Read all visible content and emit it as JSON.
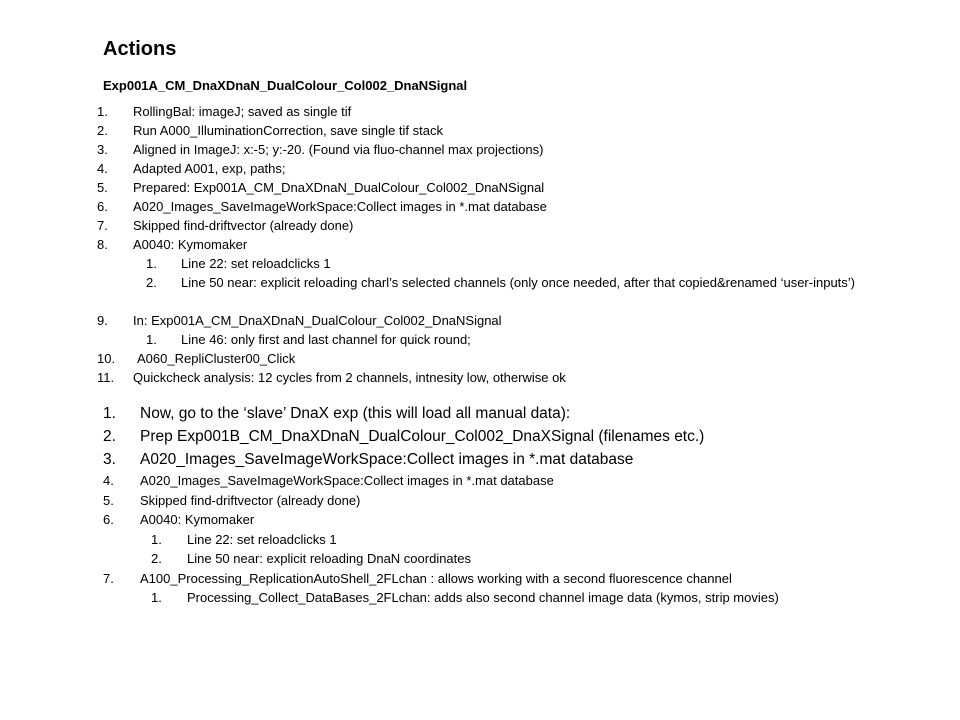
{
  "slide": {
    "title": "Actions",
    "subtitle": "Exp001A_CM_DnaXDnaN_DualColour_Col002_DnaNSignal",
    "section1": [
      {
        "num": "1.",
        "text": "RollingBal: imageJ; saved as single tif"
      },
      {
        "num": "2.",
        "text": "Run A000_IlluminationCorrection,  save single tif stack"
      },
      {
        "num": "3.",
        "text": "Aligned in ImageJ: x:-5; y:-20. (Found via fluo-channel max projections)"
      },
      {
        "num": "4.",
        "text": "Adapted A001, exp, paths;"
      },
      {
        "num": "5.",
        "text": "Prepared: Exp001A_CM_DnaXDnaN_DualColour_Col002_DnaNSignal"
      },
      {
        "num": "6.",
        "text": "A020_Images_SaveImageWorkSpace:Collect images in *.mat database"
      },
      {
        "num": "7.",
        "text": "Skipped find-driftvector (already done)"
      },
      {
        "num": "8.",
        "text": "A0040: Kymomaker"
      },
      {
        "num": "1.",
        "text": "Line 22: set reloadclicks 1"
      },
      {
        "num": "2.",
        "text": "Line 50 near: explicit reloading charl’s selected channels (only once needed, after that copied&renamed ‘user-inputs’)"
      },
      {
        "num": "9.",
        "text": "In: Exp001A_CM_DnaXDnaN_DualColour_Col002_DnaNSignal"
      },
      {
        "num": "1.",
        "text": "Line 46: only first and last channel for quick round;"
      },
      {
        "num": "10.",
        "text": "A060_RepliCluster00_Click"
      },
      {
        "num": "11.",
        "text": "Quickcheck analysis: 12 cycles from 2 channels, intnesity low, otherwise ok"
      }
    ],
    "section2": [
      {
        "num": "1.",
        "text": "Now, go to the ‘slave’  DnaX exp (this will load all manual data):"
      },
      {
        "num": "2.",
        "text": "Prep Exp001B_CM_DnaXDnaN_DualColour_Col002_DnaXSignal (filenames etc.)"
      },
      {
        "num": "3.",
        "text": "A020_Images_SaveImageWorkSpace:Collect images in *.mat database"
      },
      {
        "num": "4.",
        "text": "A020_Images_SaveImageWorkSpace:Collect images in *.mat database"
      },
      {
        "num": "5.",
        "text": "Skipped find-driftvector (already done)"
      },
      {
        "num": "6.",
        "text": "A0040: Kymomaker"
      },
      {
        "num": "1.",
        "text": "Line 22: set reloadclicks 1"
      },
      {
        "num": "2.",
        "text": "Line 50 near: explicit reloading DnaN coordinates"
      },
      {
        "num": "7.",
        "text": "A100_Processing_ReplicationAutoShell_2FLchan  : allows working with a second fluorescence channel"
      },
      {
        "num": "1.",
        "text": "Processing_Collect_DataBases_2FLchan: adds also second channel image data (kymos, strip movies)"
      }
    ]
  }
}
